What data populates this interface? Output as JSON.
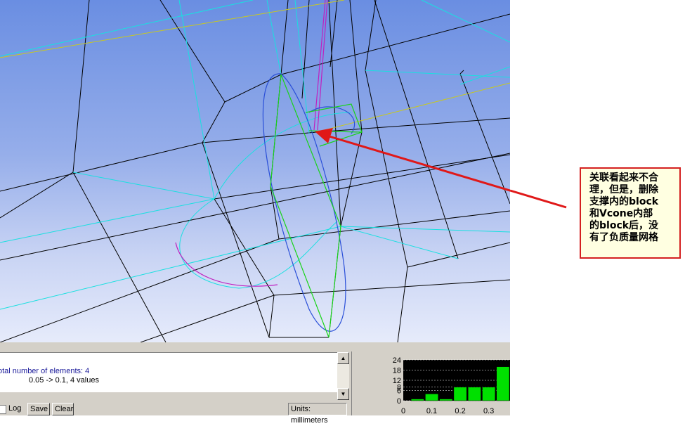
{
  "annotation": {
    "lines": [
      "关联看起来不合",
      "理，但是，删除",
      "支撑内的block",
      "和Vcone内部",
      "的block后，没",
      "有了负质量网格"
    ]
  },
  "messages": {
    "line1": "otal number of elements: 4",
    "line2": "0.05 -> 0.1, 4 values"
  },
  "toolbar": {
    "log_label": "Log",
    "save_label": "Save",
    "clear_label": "Clear",
    "units_label": "Units: millimeters"
  },
  "scrollbar": {
    "up_glyph": "▲",
    "down_glyph": "▼"
  },
  "colors": {
    "viewport_top": "#6a8ee2",
    "mesh_edges": "#000000",
    "curves_cyan": "#19e0e0",
    "curves_green": "#19d419",
    "curves_blue": "#2a4fd8",
    "curves_magenta": "#c020c0",
    "arrow": "#e01818",
    "hist_bars": "#00e000"
  },
  "chart_data": {
    "type": "bar",
    "x": [
      0.05,
      0.1,
      0.15,
      0.2,
      0.25,
      0.3,
      0.35
    ],
    "values": [
      1,
      4,
      1,
      8,
      8,
      8,
      20
    ],
    "ylim": [
      0,
      24
    ],
    "yticks": [
      "24",
      "18",
      "12",
      "8",
      "6",
      "0"
    ],
    "xticks": [
      "0",
      "0.1",
      "0.2",
      "0.3"
    ]
  }
}
